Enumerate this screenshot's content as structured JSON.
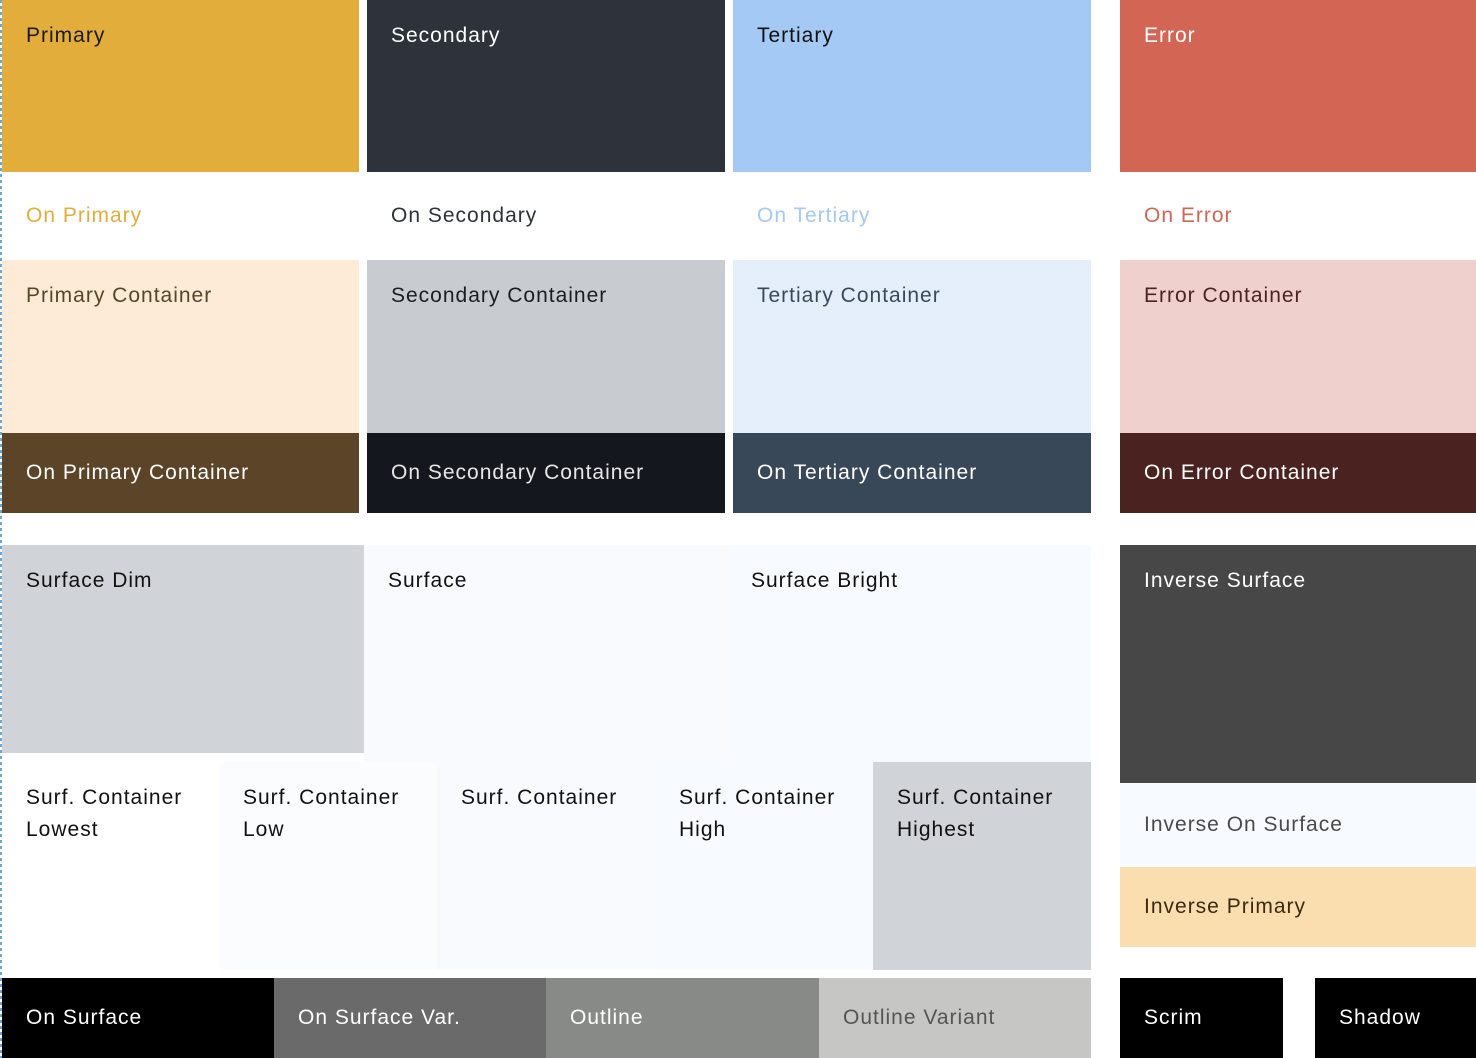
{
  "palette": {
    "primary": {
      "label": "Primary",
      "bg": "#E3AD3B",
      "fg": "#1A1A1A"
    },
    "secondary": {
      "label": "Secondary",
      "bg": "#2E323A",
      "fg": "#FFFFFF"
    },
    "tertiary": {
      "label": "Tertiary",
      "bg": "#A3C9F4",
      "fg": "#111111"
    },
    "error": {
      "label": "Error",
      "bg": "#D36555",
      "fg": "#FFFFFF"
    },
    "on_primary": {
      "label": "On Primary",
      "bg": "#FFFFFF",
      "fg": "#E3AD3B"
    },
    "on_secondary": {
      "label": "On Secondary",
      "bg": "#FFFFFF",
      "fg": "#2E323A"
    },
    "on_tertiary": {
      "label": "On Tertiary",
      "bg": "#FFFFFF",
      "fg": "#A3C9F4"
    },
    "on_error": {
      "label": "On Error",
      "bg": "#FFFFFF",
      "fg": "#D36555"
    },
    "primary_container": {
      "label": "Primary Container",
      "bg": "#FDEBD8",
      "fg": "#5A4428"
    },
    "secondary_container": {
      "label": "Secondary Container",
      "bg": "#C8CBCF",
      "fg": "#1A1D22"
    },
    "tertiary_container": {
      "label": "Tertiary Container",
      "bg": "#E5EFFC",
      "fg": "#3A4A5A"
    },
    "error_container": {
      "label": "Error Container",
      "bg": "#F0D0CC",
      "fg": "#4A2420"
    },
    "on_primary_container": {
      "label": "On Primary Container",
      "bg": "#5B4427",
      "fg": "#FFFFFF"
    },
    "on_secondary_container": {
      "label": "On Secondary Container",
      "bg": "#14171D",
      "fg": "#E6E6E6"
    },
    "on_tertiary_container": {
      "label": "On Tertiary Container",
      "bg": "#394858",
      "fg": "#FFFFFF"
    },
    "on_error_container": {
      "label": "On Error Container",
      "bg": "#4A2320",
      "fg": "#FFFFFF"
    },
    "surface_dim": {
      "label": "Surface Dim",
      "bg": "#D0D3D7",
      "fg": "#111111"
    },
    "surface": {
      "label": "Surface",
      "bg": "#F8FAFE",
      "fg": "#111111"
    },
    "surface_bright": {
      "label": "Surface Bright",
      "bg": "#F7FAFE",
      "fg": "#111111"
    },
    "inverse_surface": {
      "label": "Inverse Surface",
      "bg": "#474747",
      "fg": "#FFFFFF"
    },
    "surf_container_lowest": {
      "label": "Surf. Container\nLowest",
      "bg": "#FFFFFF",
      "fg": "#111111"
    },
    "surf_container_low": {
      "label": "Surf. Container\nLow",
      "bg": "#FBFCFE",
      "fg": "#111111"
    },
    "surf_container": {
      "label": "Surf. Container",
      "bg": "#F8FAFE",
      "fg": "#111111"
    },
    "surf_container_high": {
      "label": "Surf. Container\nHigh",
      "bg": "#F7FAFE",
      "fg": "#111111"
    },
    "surf_container_highest": {
      "label": "Surf. Container\nHighest",
      "bg": "#D0D3D7",
      "fg": "#111111"
    },
    "inverse_on_surface": {
      "label": "Inverse On Surface",
      "bg": "#F7FAFE",
      "fg": "#4A4A4A"
    },
    "inverse_primary": {
      "label": "Inverse Primary",
      "bg": "#FADEB0",
      "fg": "#3A2A10"
    },
    "on_surface": {
      "label": "On Surface",
      "bg": "#000000",
      "fg": "#FFFFFF"
    },
    "on_surface_var": {
      "label": "On Surface Var.",
      "bg": "#6A6A6A",
      "fg": "#FFFFFF"
    },
    "outline": {
      "label": "Outline",
      "bg": "#888A87",
      "fg": "#FFFFFF"
    },
    "outline_variant": {
      "label": "Outline Variant",
      "bg": "#C6C6C4",
      "fg": "#555555"
    },
    "scrim": {
      "label": "Scrim",
      "bg": "#000000",
      "fg": "#FFFFFF"
    },
    "shadow": {
      "label": "Shadow",
      "bg": "#000000",
      "fg": "#FFFFFF"
    }
  }
}
